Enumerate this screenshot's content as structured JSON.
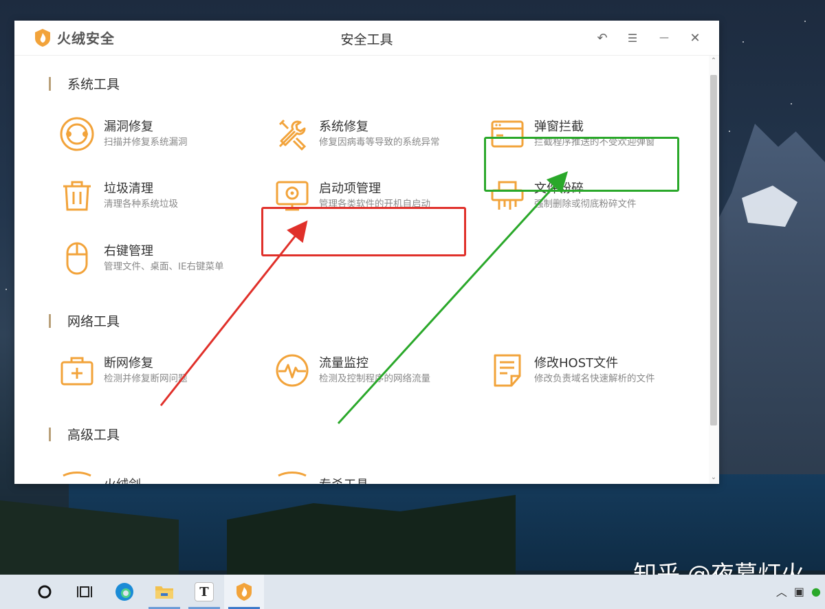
{
  "app": {
    "name": "火绒安全",
    "window_title": "安全工具"
  },
  "controls": {
    "back": "↶",
    "menu": "☰",
    "minimize": "—",
    "close": "✕"
  },
  "sections": {
    "system": {
      "title": "系统工具",
      "tools": [
        {
          "name": "漏洞修复",
          "desc": "扫描并修复系统漏洞",
          "icon": "vulnerability-repair-icon"
        },
        {
          "name": "系统修复",
          "desc": "修复因病毒等导致的系统异常",
          "icon": "wrench-screwdriver-icon"
        },
        {
          "name": "弹窗拦截",
          "desc": "拦截程序推送的不受欢迎弹窗",
          "icon": "popup-window-icon"
        },
        {
          "name": "垃圾清理",
          "desc": "清理各种系统垃圾",
          "icon": "trash-can-icon"
        },
        {
          "name": "启动项管理",
          "desc": "管理各类软件的开机自启动",
          "icon": "monitor-startup-icon"
        },
        {
          "name": "文件粉碎",
          "desc": "强制删除或彻底粉碎文件",
          "icon": "shredder-icon"
        },
        {
          "name": "右键管理",
          "desc": "管理文件、桌面、IE右键菜单",
          "icon": "mouse-icon"
        }
      ]
    },
    "network": {
      "title": "网络工具",
      "tools": [
        {
          "name": "断网修复",
          "desc": "检测并修复断网问题",
          "icon": "first-aid-kit-icon"
        },
        {
          "name": "流量监控",
          "desc": "检测及控制程序的网络流量",
          "icon": "traffic-pulse-icon"
        },
        {
          "name": "修改HOST文件",
          "desc": "修改负责域名快速解析的文件",
          "icon": "document-edit-icon"
        }
      ]
    },
    "advanced": {
      "title": "高级工具",
      "tools": [
        {
          "name": "火绒剑",
          "icon": "shield-sword-icon"
        },
        {
          "name": "专杀工具",
          "icon": "shield-tool-icon"
        }
      ]
    }
  },
  "taskbar": {
    "items": [
      "search-circle-icon",
      "task-view-icon",
      "edge-browser-icon",
      "file-explorer-icon",
      "typora-icon",
      "huorong-icon"
    ],
    "typora_letter": "T"
  },
  "watermark": "知乎 @夜幕灯火",
  "colors": {
    "accent": "#f2a33a",
    "red_highlight": "#e0302a",
    "green_highlight": "#2aa82a"
  }
}
